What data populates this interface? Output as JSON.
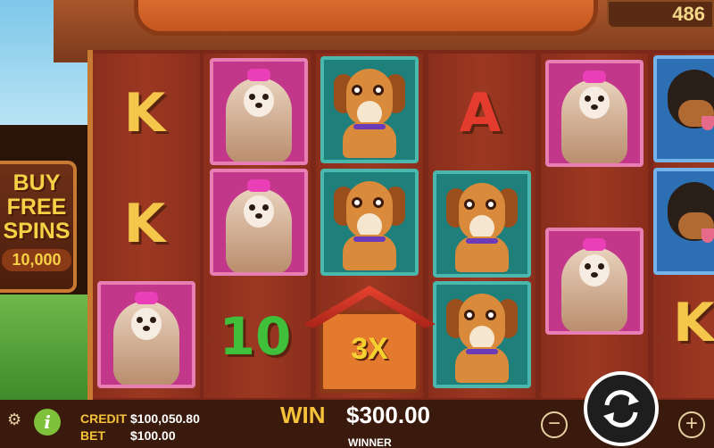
{
  "header": {
    "counter_partial": "486"
  },
  "buy_panel": {
    "line1": "BUY",
    "line2": "FREE",
    "line3": "SPINS",
    "price": "10,000"
  },
  "reels": {
    "col1": {
      "row1": "K",
      "row2": "K"
    },
    "col3": {
      "row1": "A"
    },
    "col2": {
      "row3": "10"
    },
    "col6": {
      "row3": "K"
    }
  },
  "multiplier": {
    "label": "3X"
  },
  "footer": {
    "credit_label": "CREDIT",
    "credit_value": "$100,050.80",
    "bet_label": "BET",
    "bet_value": "$100.00",
    "win_label": "WIN",
    "win_value": "$300.00",
    "winner_text": "WINNER",
    "minus": "−",
    "plus": "+",
    "info": "i",
    "gear": "⚙"
  },
  "icons": [
    "gear-icon",
    "info-icon",
    "minus-icon",
    "plus-icon",
    "spin-icon"
  ],
  "colors": {
    "accent_gold": "#f6c23a",
    "reel_bg": "#7b2818",
    "card_pink": "#c2378a",
    "card_teal": "#1f7f7a",
    "info_green": "#7fc13a"
  }
}
